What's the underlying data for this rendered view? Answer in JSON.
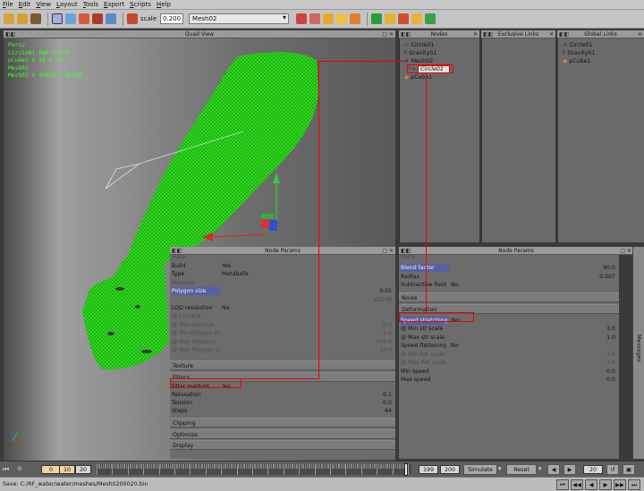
{
  "menu": [
    "File",
    "Edit",
    "View",
    "Layout",
    "Tools",
    "Export",
    "Scripts",
    "Help"
  ],
  "toolbar": {
    "scale_label": "scale",
    "scale_value": "0.200",
    "selected_object": "Mesh02"
  },
  "quad_view": {
    "title": "Quad View",
    "info_lines": [
      "Persp",
      "Circle01  PAR 31570",
      "pCube1  V 16 F 20",
      "Mesh02",
      "Mesh02 V 40652 F 80248"
    ]
  },
  "nodes_panel": {
    "title": "Nodes",
    "items": [
      {
        "label": "Circle01",
        "prefix": "-+"
      },
      {
        "label": "Gravity01",
        "prefix": "-Y"
      },
      {
        "label": "Mesh02",
        "prefix": "-+"
      },
      {
        "label": "Circle01",
        "prefix": "└+",
        "selected": true
      },
      {
        "label": "pCube1",
        "prefix": "-◆"
      }
    ]
  },
  "exclusive_links_panel": {
    "title": "Exclusive Links"
  },
  "global_links_panel": {
    "title": "Global Links",
    "items": [
      {
        "label": "Circle01",
        "prefix": "-+"
      },
      {
        "label": "Gravity01",
        "prefix": "-Y"
      },
      {
        "label": "pCube1",
        "prefix": "-◆"
      }
    ]
  },
  "node_params_left": {
    "title": "Node Params",
    "top_cut": "Mesh",
    "rows_a": [
      {
        "label": "Build",
        "value": "Yes"
      },
      {
        "label": "Type",
        "value": "Metaballs"
      },
      {
        "label": "Relative",
        "value": "",
        "dim": true
      },
      {
        "label": "Polygon size",
        "value": "0.01",
        "highlight": true
      },
      {
        "label": "",
        "value": "60248",
        "dim": true
      },
      {
        "label": "LOD resolution",
        "value": "No"
      },
      {
        "label": "@ Camera",
        "value": "",
        "dim": true
      },
      {
        "label": "@ Min distance",
        "value": "0.0",
        "dim": true
      },
      {
        "label": "@ Min Polygon size",
        "value": "1.0",
        "dim": true
      },
      {
        "label": "@ Max distance",
        "value": "100.0",
        "dim": true
      },
      {
        "label": "@ Max Polygon size",
        "value": "10.0",
        "dim": true
      }
    ],
    "sections_a": [
      "Texture",
      "Filters"
    ],
    "filter_rows": [
      {
        "label": "Filter method",
        "value": "Yes"
      },
      {
        "label": "Relaxation",
        "value": "0.1"
      },
      {
        "label": "Tension",
        "value": "0.0"
      },
      {
        "label": "Steps",
        "value": "64"
      }
    ],
    "sections_b": [
      "Clipping",
      "Optimize",
      "Display"
    ]
  },
  "node_params_right": {
    "title": "Node Params",
    "top_cut": "Meta",
    "rows_a": [
      {
        "label": "Blend factor",
        "value": "90.0",
        "highlight": true
      },
      {
        "label": "Radius",
        "value": "0.007"
      },
      {
        "label": "Subtractive field",
        "value": "No"
      }
    ],
    "sections": [
      "Noise",
      "Deformation"
    ],
    "rows_b": [
      {
        "label": "Speed stretching",
        "value": "Yes",
        "highlight": true
      },
      {
        "label": "@ Min str scale",
        "value": "1.0"
      },
      {
        "label": "@ Max str scale",
        "value": "1.0"
      },
      {
        "label": "Speed flattening",
        "value": "No"
      },
      {
        "label": "@ Min flat scale",
        "value": "1.0",
        "dim": true
      },
      {
        "label": "@ Max flat scale",
        "value": "1.0",
        "dim": true
      },
      {
        "label": "Min speed",
        "value": "0.0"
      },
      {
        "label": "Max speed",
        "value": "0.0"
      }
    ]
  },
  "messages_tab": "Messages",
  "timeline": {
    "start": "0",
    "current_a": "0",
    "range_a": "10",
    "current_b": "20",
    "ticks": [
      "0",
      "10",
      "20",
      "30",
      "40",
      "50",
      "60",
      "70",
      "80",
      "90",
      "100",
      "110",
      "120",
      "130",
      "140",
      "150",
      "160",
      "170",
      "180",
      "190",
      "200"
    ],
    "end_a": "199",
    "end_b": "200",
    "simulate": "Simulate",
    "reset": "Reset",
    "frame": "20"
  },
  "status": "Save: C:/RF_water/water/meshes/Mesh0200020.bin",
  "colors": {
    "mesh": "#2fd81e",
    "highlight": "#5560a8",
    "annotation": "#e00000",
    "info_text": "#3cff2a"
  }
}
